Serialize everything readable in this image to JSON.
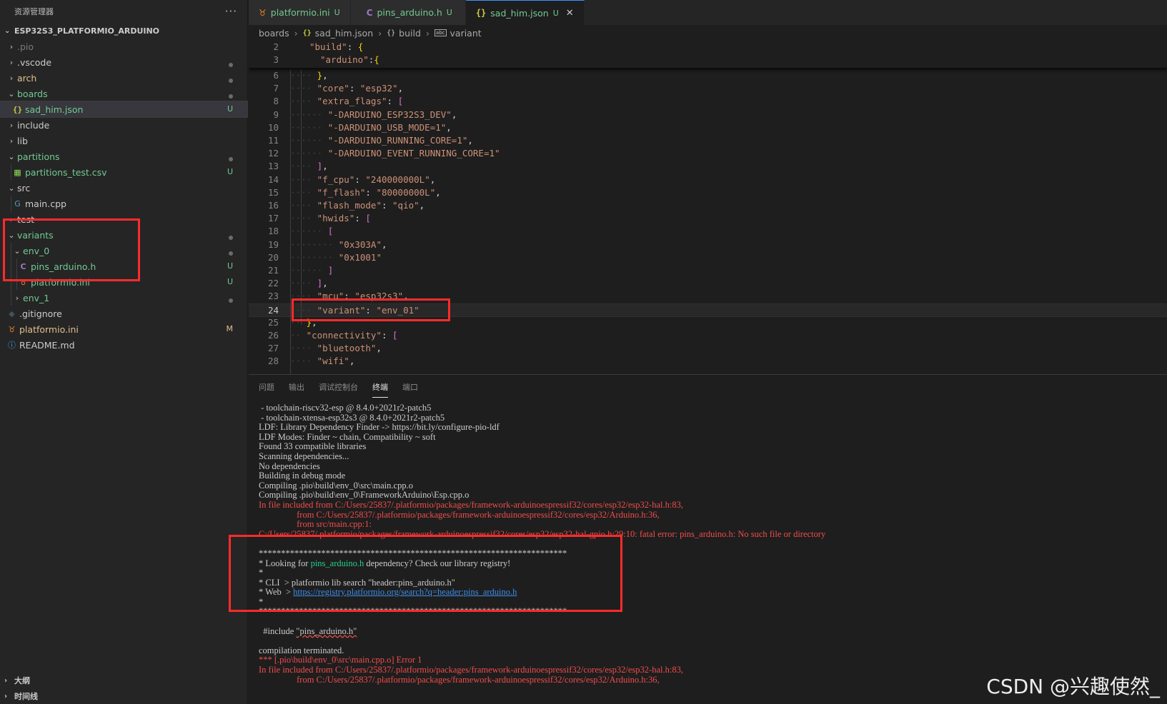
{
  "sidebar": {
    "title": "资源管理器",
    "more_glyph": "···",
    "root": "ESP32S3_PLATFORMIO_ARDUINO",
    "items": [
      {
        "label": ".pio",
        "kind": "folder",
        "badge": "",
        "dot": false,
        "state": "dim"
      },
      {
        "label": ".vscode",
        "kind": "folder",
        "badge": "",
        "dot": true,
        "state": "normal"
      },
      {
        "label": "arch",
        "kind": "folder",
        "badge": "",
        "dot": true,
        "state": "mod"
      },
      {
        "label": "boards",
        "kind": "folder-open",
        "badge": "",
        "dot": true,
        "state": "u"
      },
      {
        "label": "sad_him.json",
        "kind": "json",
        "badge": "U",
        "dot": false,
        "state": "u",
        "selected": true
      },
      {
        "label": "include",
        "kind": "folder",
        "badge": "",
        "dot": false,
        "state": "normal"
      },
      {
        "label": "lib",
        "kind": "folder",
        "badge": "",
        "dot": false,
        "state": "normal"
      },
      {
        "label": "partitions",
        "kind": "folder-open",
        "badge": "",
        "dot": true,
        "state": "u"
      },
      {
        "label": "partitions_test.csv",
        "kind": "csv",
        "badge": "U",
        "dot": false,
        "state": "u"
      },
      {
        "label": "src",
        "kind": "folder-open",
        "badge": "",
        "dot": false,
        "state": "normal"
      },
      {
        "label": "main.cpp",
        "kind": "cpp",
        "badge": "",
        "dot": false,
        "state": "normal"
      },
      {
        "label": "test",
        "kind": "folder",
        "badge": "",
        "dot": false,
        "state": "normal"
      },
      {
        "label": "variants",
        "kind": "folder-open",
        "badge": "",
        "dot": true,
        "state": "u"
      },
      {
        "label": "env_0",
        "kind": "folder-open",
        "badge": "",
        "dot": true,
        "state": "u"
      },
      {
        "label": "pins_arduino.h",
        "kind": "c",
        "badge": "U",
        "dot": false,
        "state": "u"
      },
      {
        "label": "platformio.ini",
        "kind": "pio",
        "badge": "U",
        "dot": false,
        "state": "u"
      },
      {
        "label": "env_1",
        "kind": "folder",
        "badge": "",
        "dot": true,
        "state": "u"
      },
      {
        "label": ".gitignore",
        "kind": "git",
        "badge": "",
        "dot": false,
        "state": "normal"
      },
      {
        "label": "platformio.ini",
        "kind": "pio",
        "badge": "M",
        "dot": false,
        "state": "mod"
      },
      {
        "label": "README.md",
        "kind": "info",
        "badge": "",
        "dot": false,
        "state": "normal"
      }
    ],
    "bottom_sections": [
      "大纲",
      "时间线"
    ]
  },
  "tabs": [
    {
      "label": "platformio.ini",
      "icon": "platformio-icon",
      "badge": "U",
      "active": false
    },
    {
      "label": "pins_arduino.h",
      "icon": "c-file-icon",
      "badge": "U",
      "active": false
    },
    {
      "label": "sad_him.json",
      "icon": "json-file-icon",
      "badge": "U",
      "active": true
    }
  ],
  "breadcrumb": {
    "items": [
      "boards",
      "sad_him.json",
      "build",
      "variant"
    ]
  },
  "editor": {
    "sticky": [
      {
        "ln": "2",
        "text": "\"build\": {"
      },
      {
        "ln": "3",
        "text": "\"arduino\":{"
      }
    ],
    "lines": [
      {
        "ln": "6",
        "text": "},",
        "current": false
      },
      {
        "ln": "7",
        "text": "\"core\": \"esp32\",",
        "current": false
      },
      {
        "ln": "8",
        "text": "\"extra_flags\": [",
        "current": false
      },
      {
        "ln": "9",
        "text": "\"-DARDUINO_ESP32S3_DEV\",",
        "current": false
      },
      {
        "ln": "10",
        "text": "\"-DARDUINO_USB_MODE=1\",",
        "current": false
      },
      {
        "ln": "11",
        "text": "\"-DARDUINO_RUNNING_CORE=1\",",
        "current": false
      },
      {
        "ln": "12",
        "text": "\"-DARDUINO_EVENT_RUNNING_CORE=1\"",
        "current": false
      },
      {
        "ln": "13",
        "text": "],",
        "current": false
      },
      {
        "ln": "14",
        "text": "\"f_cpu\": \"240000000L\",",
        "current": false
      },
      {
        "ln": "15",
        "text": "\"f_flash\": \"80000000L\",",
        "current": false
      },
      {
        "ln": "16",
        "text": "\"flash_mode\": \"qio\",",
        "current": false
      },
      {
        "ln": "17",
        "text": "\"hwids\": [",
        "current": false
      },
      {
        "ln": "18",
        "text": "[",
        "current": false
      },
      {
        "ln": "19",
        "text": "\"0x303A\",",
        "current": false
      },
      {
        "ln": "20",
        "text": "\"0x1001\"",
        "current": false
      },
      {
        "ln": "21",
        "text": "]",
        "current": false
      },
      {
        "ln": "22",
        "text": "],",
        "current": false
      },
      {
        "ln": "23",
        "text": "\"mcu\": \"esp32s3\",",
        "current": false
      },
      {
        "ln": "24",
        "text": "\"variant\": \"env_01\"",
        "current": true
      },
      {
        "ln": "25",
        "text": "},",
        "current": false
      },
      {
        "ln": "26",
        "text": "\"connectivity\": [",
        "current": false
      },
      {
        "ln": "27",
        "text": "\"bluetooth\",",
        "current": false
      },
      {
        "ln": "28",
        "text": "\"wifi\",",
        "current": false
      }
    ]
  },
  "panel": {
    "tabs": [
      {
        "label": "问题",
        "active": false
      },
      {
        "label": "输出",
        "active": false
      },
      {
        "label": "调试控制台",
        "active": false
      },
      {
        "label": "终端",
        "active": true
      },
      {
        "label": "端口",
        "active": false
      }
    ],
    "terminal": [
      {
        "text": " - toolchain-riscv32-esp @ 8.4.0+2021r2-patch5",
        "kind": "normal"
      },
      {
        "text": " - toolchain-xtensa-esp32s3 @ 8.4.0+2021r2-patch5",
        "kind": "normal"
      },
      {
        "text": "LDF: Library Dependency Finder -> https://bit.ly/configure-pio-ldf",
        "kind": "normal"
      },
      {
        "text": "LDF Modes: Finder ~ chain, Compatibility ~ soft",
        "kind": "normal"
      },
      {
        "text": "Found 33 compatible libraries",
        "kind": "normal"
      },
      {
        "text": "Scanning dependencies...",
        "kind": "normal"
      },
      {
        "text": "No dependencies",
        "kind": "normal"
      },
      {
        "text": "Building in debug mode",
        "kind": "normal"
      },
      {
        "text": "Compiling .pio\\build\\env_0\\src\\main.cpp.o",
        "kind": "normal"
      },
      {
        "text": "Compiling .pio\\build\\env_0\\FrameworkArduino\\Esp.cpp.o",
        "kind": "normal"
      },
      {
        "text": "In file included from C:/Users/25837/.platformio/packages/framework-arduinoespressif32/cores/esp32/esp32-hal.h:83,",
        "kind": "err"
      },
      {
        "text": "                 from C:/Users/25837/.platformio/packages/framework-arduinoespressif32/cores/esp32/Arduino.h:36,",
        "kind": "err"
      },
      {
        "text": "                 from src/main.cpp:1:",
        "kind": "err"
      },
      {
        "text": "C:/Users/25837/.platformio/packages/framework-arduinoespressif32/cores/esp32/esp32-hal-gpio.h:29:10: fatal error: pins_arduino.h: No such file or directory",
        "kind": "err"
      },
      {
        "text": "",
        "kind": "normal"
      },
      {
        "text": "*********************************************************************",
        "kind": "normal"
      },
      {
        "text": "* Looking for pins_arduino.h dependency? Check our library registry!",
        "kind": "look"
      },
      {
        "text": "*",
        "kind": "normal"
      },
      {
        "text": "* CLI  > platformio lib search \"header:pins_arduino.h\"",
        "kind": "normal"
      },
      {
        "text": "* Web  > https://registry.platformio.org/search?q=header:pins_arduino.h",
        "kind": "web"
      },
      {
        "text": "*",
        "kind": "normal"
      },
      {
        "text": "*********************************************************************",
        "kind": "normal"
      },
      {
        "text": "",
        "kind": "normal"
      },
      {
        "text": "  #include \"pins_arduino.h\"",
        "kind": "include"
      },
      {
        "text": "",
        "kind": "normal"
      },
      {
        "text": "compilation terminated.",
        "kind": "normal"
      },
      {
        "text": "*** [.pio\\build\\env_0\\src\\main.cpp.o] Error 1",
        "kind": "err"
      },
      {
        "text": "In file included from C:/Users/25837/.platformio/packages/framework-arduinoespressif32/cores/esp32/esp32-hal.h:83,",
        "kind": "err"
      },
      {
        "text": "                 from C:/Users/25837/.platformio/packages/framework-arduinoespressif32/cores/esp32/Arduino.h:36,",
        "kind": "err"
      }
    ],
    "look_parts": {
      "prefix": "* Looking for ",
      "highlight": "pins_arduino.h",
      "suffix": " dependency? Check our library registry!"
    },
    "web_parts": {
      "prefix": "* Web  > ",
      "link": "https://registry.platformio.org/search?q=header:pins_arduino.h"
    },
    "include_parts": {
      "prefix": "  #include ",
      "wavy": "\"pins_arduino.h\""
    }
  },
  "watermark": "CSDN @兴趣使然_",
  "colors": {
    "accent": "#3794ff",
    "git_untracked": "#73c991",
    "git_modified": "#e2c08d",
    "annotation_red": "#ff2b2b"
  }
}
